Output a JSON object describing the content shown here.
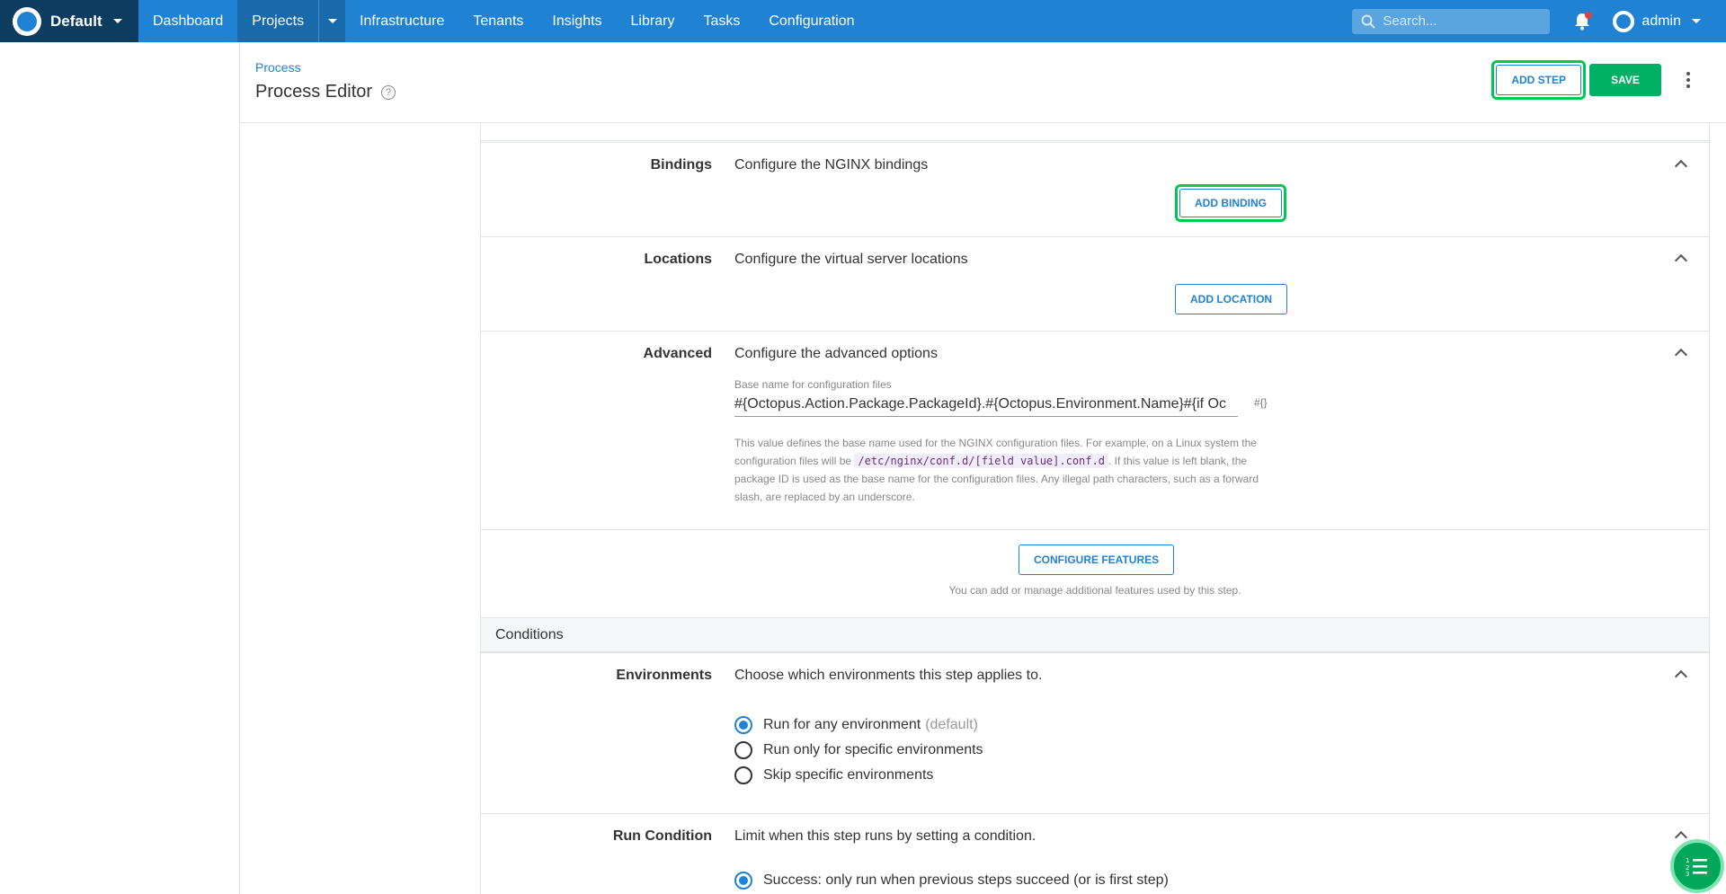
{
  "nav": {
    "space": "Default",
    "items": [
      "Dashboard",
      "Projects",
      "Infrastructure",
      "Tenants",
      "Insights",
      "Library",
      "Tasks",
      "Configuration"
    ],
    "search_placeholder": "Search...",
    "user": "admin"
  },
  "header": {
    "breadcrumb": "Process",
    "title": "Process Editor",
    "add_step": "ADD STEP",
    "save": "SAVE"
  },
  "sections": {
    "bindings": {
      "label": "Bindings",
      "desc": "Configure the NGINX bindings",
      "button": "ADD BINDING"
    },
    "locations": {
      "label": "Locations",
      "desc": "Configure the virtual server locations",
      "button": "ADD LOCATION"
    },
    "advanced": {
      "label": "Advanced",
      "desc": "Configure the advanced options",
      "field_label": "Base name for configuration files",
      "field_value": "#{Octopus.Action.Package.PackageId}.#{Octopus.Environment.Name}#{if Oc",
      "var_icon": "#{}",
      "help_1": "This value defines the base name used for the NGINX configuration files. For example, on a Linux system the configuration files will be",
      "help_code": "/etc/nginx/conf.d/[field value].conf.d",
      "help_2": ". If this value is left blank, the package ID is used as the base name for the configuration files. Any illegal path characters, such as a forward slash, are replaced by an underscore."
    },
    "features": {
      "button": "CONFIGURE FEATURES",
      "note": "You can add or manage additional features used by this step."
    },
    "conditions_title": "Conditions",
    "environments": {
      "label": "Environments",
      "desc": "Choose which environments this step applies to.",
      "options": [
        "Run for any environment",
        "Run only for specific environments",
        "Skip specific environments"
      ],
      "default_note": "(default)"
    },
    "run_condition": {
      "label": "Run Condition",
      "desc": "Limit when this step runs by setting a condition.",
      "option_1": "Success: only run when previous steps succeed (or is first step)"
    }
  },
  "colors": {
    "nav": "#1f82d2",
    "space": "#0d3c61",
    "save": "#00b065",
    "highlight": "#00c853"
  }
}
